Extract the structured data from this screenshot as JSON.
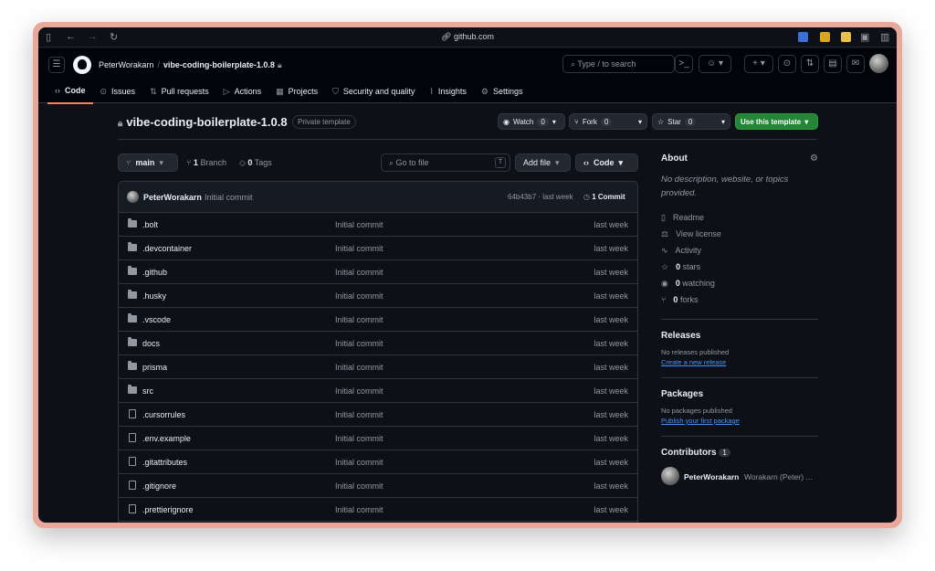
{
  "browser": {
    "url": "github.com"
  },
  "header": {
    "owner": "PeterWorakarn",
    "repo": "vibe-coding-boilerplate-1.0.8",
    "search_placeholder": "Type / to search"
  },
  "tabs": [
    {
      "label": "Code",
      "icon": "code-icon"
    },
    {
      "label": "Issues",
      "icon": "issue-icon"
    },
    {
      "label": "Pull requests",
      "icon": "pull-request-icon"
    },
    {
      "label": "Actions",
      "icon": "play-icon"
    },
    {
      "label": "Projects",
      "icon": "table-icon"
    },
    {
      "label": "Security and quality",
      "icon": "shield-icon"
    },
    {
      "label": "Insights",
      "icon": "graph-icon"
    },
    {
      "label": "Settings",
      "icon": "gear-icon"
    }
  ],
  "repo": {
    "title": "vibe-coding-boilerplate-1.0.8",
    "visibility": "Private template",
    "watch_label": "Watch",
    "watch_count": "0",
    "fork_label": "Fork",
    "fork_count": "0",
    "star_label": "Star",
    "star_count": "0",
    "use_template": "Use this template"
  },
  "branch": {
    "name": "main",
    "branches_count": "1",
    "branches_label": "Branch",
    "tags_count": "0",
    "tags_label": "Tags",
    "goto_placeholder": "Go to file",
    "goto_key": "T",
    "add_file": "Add file",
    "code": "Code"
  },
  "commit": {
    "author": "PeterWorakarn",
    "message": "Initial commit",
    "hash_time": "64b43b7 · last week",
    "count": "1 Commit"
  },
  "files": [
    {
      "name": ".bolt",
      "type": "folder",
      "message": "Initial commit",
      "date": "last week"
    },
    {
      "name": ".devcontainer",
      "type": "folder",
      "message": "Initial commit",
      "date": "last week"
    },
    {
      "name": ".github",
      "type": "folder",
      "message": "Initial commit",
      "date": "last week"
    },
    {
      "name": ".husky",
      "type": "folder",
      "message": "Initial commit",
      "date": "last week"
    },
    {
      "name": ".vscode",
      "type": "folder",
      "message": "Initial commit",
      "date": "last week"
    },
    {
      "name": "docs",
      "type": "folder",
      "message": "Initial commit",
      "date": "last week"
    },
    {
      "name": "prisma",
      "type": "folder",
      "message": "Initial commit",
      "date": "last week"
    },
    {
      "name": "src",
      "type": "folder",
      "message": "Initial commit",
      "date": "last week"
    },
    {
      "name": ".cursorrules",
      "type": "file",
      "message": "Initial commit",
      "date": "last week"
    },
    {
      "name": ".env.example",
      "type": "file",
      "message": "Initial commit",
      "date": "last week"
    },
    {
      "name": ".gitattributes",
      "type": "file",
      "message": "Initial commit",
      "date": "last week"
    },
    {
      "name": ".gitignore",
      "type": "file",
      "message": "Initial commit",
      "date": "last week"
    },
    {
      "name": ".prettierignore",
      "type": "file",
      "message": "Initial commit",
      "date": "last week"
    }
  ],
  "about": {
    "title": "About",
    "description": "No description, website, or topics provided.",
    "items": [
      {
        "icon": "book-icon",
        "label": "Readme"
      },
      {
        "icon": "law-icon",
        "label": "View license"
      },
      {
        "icon": "pulse-icon",
        "label": "Activity"
      },
      {
        "icon": "star-icon",
        "count": "0",
        "label": "stars"
      },
      {
        "icon": "eye-icon",
        "count": "0",
        "label": "watching"
      },
      {
        "icon": "fork-icon",
        "count": "0",
        "label": "forks"
      }
    ]
  },
  "releases": {
    "title": "Releases",
    "empty": "No releases published",
    "link": "Create a new release"
  },
  "packages": {
    "title": "Packages",
    "empty": "No packages published",
    "link": "Publish your first package"
  },
  "contributors": {
    "title": "Contributors",
    "count": "1",
    "name": "PeterWorakarn",
    "fullname": "Worakarn (Peter) ..."
  },
  "colors": {
    "accent_green": "#238636",
    "tab_underline": "#f78166",
    "link_blue": "#4493f8",
    "bg": "#0d1117"
  }
}
